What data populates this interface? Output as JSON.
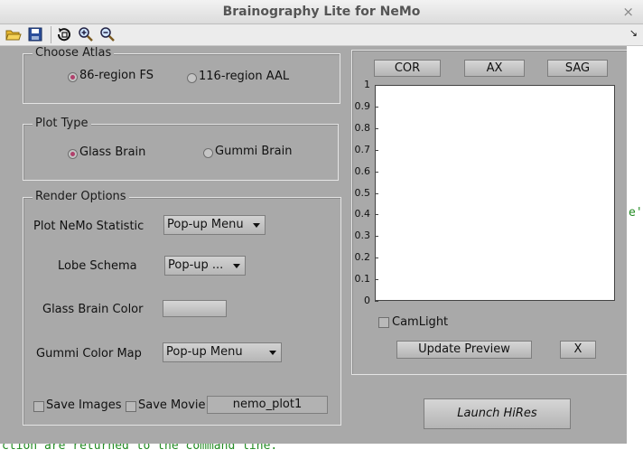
{
  "window": {
    "title": "Brainography Lite for NeMo",
    "close_label": "×"
  },
  "toolbar": {
    "icons": [
      "open-folder-icon",
      "save-icon",
      "rotate-3d-icon",
      "zoom-in-icon",
      "zoom-out-icon"
    ],
    "dock_arrow": "↘"
  },
  "atlas": {
    "label": "Choose Atlas",
    "options": [
      {
        "label": "86-region FS",
        "selected": true
      },
      {
        "label": "116-region AAL",
        "selected": false
      }
    ]
  },
  "plot_type": {
    "label": "Plot Type",
    "options": [
      {
        "label": "Glass Brain",
        "selected": true
      },
      {
        "label": "Gummi Brain",
        "selected": false
      }
    ]
  },
  "render": {
    "label": "Render Options",
    "plot_nemo_statistic": {
      "label": "Plot NeMo Statistic",
      "value": "Pop-up Menu"
    },
    "lobe_schema": {
      "label": "Lobe Schema",
      "value": "Pop-up ..."
    },
    "glass_brain_color": {
      "label": "Glass Brain Color"
    },
    "gummi_color_map": {
      "label": "Gummi Color Map",
      "value": "Pop-up Menu"
    },
    "save_images": {
      "label": "Save Images",
      "checked": false
    },
    "save_movie": {
      "label": "Save Movie",
      "checked": false
    },
    "filename": "nemo_plot1"
  },
  "preview": {
    "view_buttons": [
      "COR",
      "AX",
      "SAG"
    ],
    "camlight": {
      "label": "CamLight",
      "checked": false
    },
    "update_label": "Update Preview",
    "x_label": "X"
  },
  "chart_data": {
    "type": "line",
    "series": [],
    "title": "",
    "xlabel": "",
    "ylabel": "",
    "ylim": [
      0,
      1
    ],
    "yticks": [
      "1",
      "0.9",
      "0.8",
      "0.7",
      "0.6",
      "0.5",
      "0.4",
      "0.3",
      "0.2",
      "0.1",
      "0"
    ],
    "grid": false
  },
  "launch_label": "Launch HiRes",
  "background": {
    "command_text": "ction are returned to the command line.",
    "edge_text": "e'"
  },
  "colors": {
    "panel": "#a9a9a9",
    "radio_selected": "#b0406b",
    "command_text": "#228b22"
  }
}
